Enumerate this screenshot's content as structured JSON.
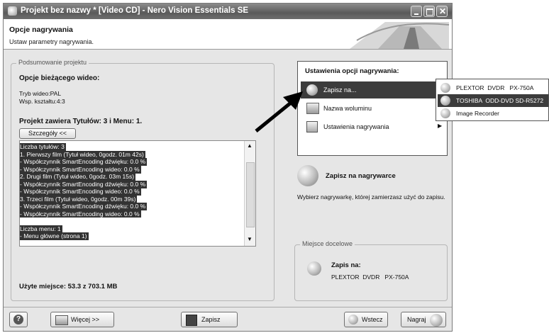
{
  "window": {
    "title": "Projekt bez nazwy * [Video CD] - Nero Vision Essentials SE"
  },
  "header": {
    "title": "Opcje nagrywania",
    "subtitle": "Ustaw parametry nagrywania."
  },
  "summary": {
    "group_label": "Podsumowanie projektu",
    "current_video_heading": "Opcje bieżącego wideo:",
    "video_mode": "Tryb wideo:PAL",
    "aspect_ratio": "Wsp. kształtu:4:3",
    "project_contents": "Projekt zawiera Tytułów: 3 i Menu: 1.",
    "details_button": "Szczegóły <<",
    "details_lines": [
      "Liczba tytułów: 3",
      "1. Pierwszy film (Tytuł wideo, 0godz. 01m 42s)",
      "- Współczynnik SmartEncoding dźwięku: 0.0 %",
      "- Współczynnik SmartEncoding wideo: 0.0 %",
      "2. Drugi film (Tytuł wideo, 0godz. 03m 15s)",
      "- Współczynnik SmartEncoding dźwięku: 0.0 %",
      "- Współczynnik SmartEncoding wideo: 0.0 %",
      "3. Trzeci film (Tytuł wideo, 0godz. 00m 39s)",
      "- Współczynnik SmartEncoding dźwięku: 0.0 %",
      "- Współczynnik SmartEncoding wideo: 0.0 %",
      "",
      "Liczba menu: 1",
      "- Menu główne (strona 1)"
    ],
    "used_space": "Użyte miejsce: 53.3 z 703.1 MB"
  },
  "burn_options": {
    "heading": "Ustawienia opcji nagrywania:",
    "items": [
      {
        "label": "Zapisz na...",
        "icon": "disc-burn-icon",
        "has_submenu": true
      },
      {
        "label": "Nazwa woluminu",
        "icon": "volume-name-icon",
        "has_submenu": true
      },
      {
        "label": "Ustawienia nagrywania",
        "icon": "burn-settings-icon",
        "has_submenu": true
      }
    ],
    "submenu": [
      {
        "label": "PLEXTOR  DVDR   PX-750A"
      },
      {
        "label": "TOSHIBA  ODD-DVD SD-R5272"
      },
      {
        "label": "Image Recorder"
      }
    ]
  },
  "burn_to": {
    "title": "Zapisz na nagrywarce",
    "description": "Wybierz nagrywarkę, której zamierzasz użyć do zapisu."
  },
  "destination": {
    "group_label": "Miejsce docelowe",
    "title": "Zapis na:",
    "device": "PLEXTOR  DVDR   PX-750A"
  },
  "footer": {
    "help_label": "?",
    "more_label": "Więcej >>",
    "save_label": "Zapisz",
    "back_label": "Wstecz",
    "burn_label": "Nagraj"
  },
  "colors": {
    "selected_bg": "#3c3c3c",
    "window_bg": "#e6e6e6"
  }
}
